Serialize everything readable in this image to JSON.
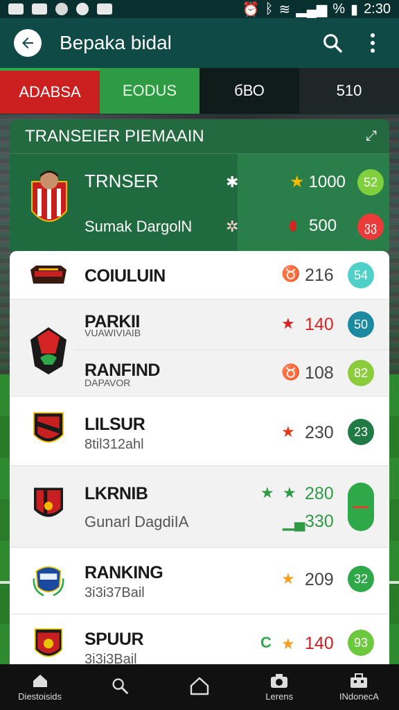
{
  "status_bar": {
    "time": "2:30",
    "battery": "%"
  },
  "app_bar": {
    "title": "Bepaka bidal",
    "back_icon": "arrow-left-icon",
    "search_icon": "search-icon",
    "menu_icon": "more-vert-icon"
  },
  "tabs": [
    {
      "label": "ADABSA"
    },
    {
      "label": "EODUS"
    },
    {
      "label": "бВО"
    },
    {
      "label": "510"
    }
  ],
  "featured": {
    "header": "TRANSEIER PIEMAAIN",
    "name": "TRNSER",
    "subtitle": "Sumak DargolN",
    "value_1": "1000",
    "value_2": "500",
    "badge_1": "52",
    "badge_2": "ვვ",
    "badge_1_color": "#7fd03c",
    "badge_2_color": "#ea3a3a"
  },
  "rows": [
    {
      "title": "COIULUIN",
      "subtitle": "",
      "value": "216",
      "badge": "54",
      "badge_color": "#4fd0c8",
      "icon_color": "#f5a020"
    },
    {
      "title": "PARKII",
      "subtitle": "VUAWIVIAIB",
      "value": "140",
      "badge": "50",
      "badge_color": "#1a8aa0",
      "icon_color": "#d42424"
    },
    {
      "title": "RANFIND",
      "subtitle": "DAPAVOR",
      "value": "108",
      "badge": "82",
      "badge_color": "#8ccc3c",
      "icon_color": "#f5a020"
    },
    {
      "title": "LILSUR",
      "subtitle": "8til312ahl",
      "value": "230",
      "badge": "23",
      "badge_color": "#1f7a44",
      "icon_color": "#e23a1a"
    },
    {
      "title": "LKRNIB",
      "subtitle": "Gunarl DagdiIA",
      "value": "280",
      "value_2": "330",
      "badge": "",
      "badge_color": "#2fa84a",
      "icon_color": "#2f9a44"
    },
    {
      "title": "RANKING",
      "subtitle": "3i3i37Bail",
      "value": "209",
      "badge": "32",
      "badge_color": "#2fa84a",
      "icon_color": "#f5a020"
    },
    {
      "title": "SPUUR",
      "subtitle": "3i3i3Bail",
      "value": "140",
      "badge": "93",
      "badge_color": "#6cc83c",
      "icon_color": "#f5a020",
      "prefix": "C"
    }
  ],
  "bottom_nav": [
    {
      "label": "Diestoisids",
      "icon": "home-icon"
    },
    {
      "label": "",
      "icon": "search-icon"
    },
    {
      "label": "",
      "icon": "house-outline-icon"
    },
    {
      "label": "Lerens",
      "icon": "camera-icon"
    },
    {
      "label": "INdonecA",
      "icon": "briefcase-icon"
    }
  ]
}
